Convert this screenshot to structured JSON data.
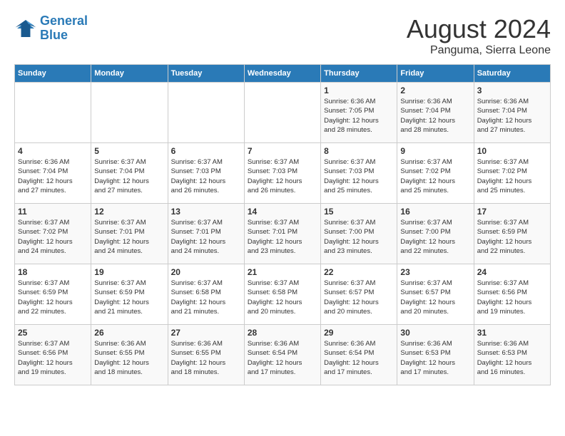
{
  "header": {
    "logo_line1": "General",
    "logo_line2": "Blue",
    "month": "August 2024",
    "location": "Panguma, Sierra Leone"
  },
  "weekdays": [
    "Sunday",
    "Monday",
    "Tuesday",
    "Wednesday",
    "Thursday",
    "Friday",
    "Saturday"
  ],
  "weeks": [
    [
      {
        "day": "",
        "info": ""
      },
      {
        "day": "",
        "info": ""
      },
      {
        "day": "",
        "info": ""
      },
      {
        "day": "",
        "info": ""
      },
      {
        "day": "1",
        "info": "Sunrise: 6:36 AM\nSunset: 7:05 PM\nDaylight: 12 hours\nand 28 minutes."
      },
      {
        "day": "2",
        "info": "Sunrise: 6:36 AM\nSunset: 7:04 PM\nDaylight: 12 hours\nand 28 minutes."
      },
      {
        "day": "3",
        "info": "Sunrise: 6:36 AM\nSunset: 7:04 PM\nDaylight: 12 hours\nand 27 minutes."
      }
    ],
    [
      {
        "day": "4",
        "info": "Sunrise: 6:36 AM\nSunset: 7:04 PM\nDaylight: 12 hours\nand 27 minutes."
      },
      {
        "day": "5",
        "info": "Sunrise: 6:37 AM\nSunset: 7:04 PM\nDaylight: 12 hours\nand 27 minutes."
      },
      {
        "day": "6",
        "info": "Sunrise: 6:37 AM\nSunset: 7:03 PM\nDaylight: 12 hours\nand 26 minutes."
      },
      {
        "day": "7",
        "info": "Sunrise: 6:37 AM\nSunset: 7:03 PM\nDaylight: 12 hours\nand 26 minutes."
      },
      {
        "day": "8",
        "info": "Sunrise: 6:37 AM\nSunset: 7:03 PM\nDaylight: 12 hours\nand 25 minutes."
      },
      {
        "day": "9",
        "info": "Sunrise: 6:37 AM\nSunset: 7:02 PM\nDaylight: 12 hours\nand 25 minutes."
      },
      {
        "day": "10",
        "info": "Sunrise: 6:37 AM\nSunset: 7:02 PM\nDaylight: 12 hours\nand 25 minutes."
      }
    ],
    [
      {
        "day": "11",
        "info": "Sunrise: 6:37 AM\nSunset: 7:02 PM\nDaylight: 12 hours\nand 24 minutes."
      },
      {
        "day": "12",
        "info": "Sunrise: 6:37 AM\nSunset: 7:01 PM\nDaylight: 12 hours\nand 24 minutes."
      },
      {
        "day": "13",
        "info": "Sunrise: 6:37 AM\nSunset: 7:01 PM\nDaylight: 12 hours\nand 24 minutes."
      },
      {
        "day": "14",
        "info": "Sunrise: 6:37 AM\nSunset: 7:01 PM\nDaylight: 12 hours\nand 23 minutes."
      },
      {
        "day": "15",
        "info": "Sunrise: 6:37 AM\nSunset: 7:00 PM\nDaylight: 12 hours\nand 23 minutes."
      },
      {
        "day": "16",
        "info": "Sunrise: 6:37 AM\nSunset: 7:00 PM\nDaylight: 12 hours\nand 22 minutes."
      },
      {
        "day": "17",
        "info": "Sunrise: 6:37 AM\nSunset: 6:59 PM\nDaylight: 12 hours\nand 22 minutes."
      }
    ],
    [
      {
        "day": "18",
        "info": "Sunrise: 6:37 AM\nSunset: 6:59 PM\nDaylight: 12 hours\nand 22 minutes."
      },
      {
        "day": "19",
        "info": "Sunrise: 6:37 AM\nSunset: 6:59 PM\nDaylight: 12 hours\nand 21 minutes."
      },
      {
        "day": "20",
        "info": "Sunrise: 6:37 AM\nSunset: 6:58 PM\nDaylight: 12 hours\nand 21 minutes."
      },
      {
        "day": "21",
        "info": "Sunrise: 6:37 AM\nSunset: 6:58 PM\nDaylight: 12 hours\nand 20 minutes."
      },
      {
        "day": "22",
        "info": "Sunrise: 6:37 AM\nSunset: 6:57 PM\nDaylight: 12 hours\nand 20 minutes."
      },
      {
        "day": "23",
        "info": "Sunrise: 6:37 AM\nSunset: 6:57 PM\nDaylight: 12 hours\nand 20 minutes."
      },
      {
        "day": "24",
        "info": "Sunrise: 6:37 AM\nSunset: 6:56 PM\nDaylight: 12 hours\nand 19 minutes."
      }
    ],
    [
      {
        "day": "25",
        "info": "Sunrise: 6:37 AM\nSunset: 6:56 PM\nDaylight: 12 hours\nand 19 minutes."
      },
      {
        "day": "26",
        "info": "Sunrise: 6:36 AM\nSunset: 6:55 PM\nDaylight: 12 hours\nand 18 minutes."
      },
      {
        "day": "27",
        "info": "Sunrise: 6:36 AM\nSunset: 6:55 PM\nDaylight: 12 hours\nand 18 minutes."
      },
      {
        "day": "28",
        "info": "Sunrise: 6:36 AM\nSunset: 6:54 PM\nDaylight: 12 hours\nand 17 minutes."
      },
      {
        "day": "29",
        "info": "Sunrise: 6:36 AM\nSunset: 6:54 PM\nDaylight: 12 hours\nand 17 minutes."
      },
      {
        "day": "30",
        "info": "Sunrise: 6:36 AM\nSunset: 6:53 PM\nDaylight: 12 hours\nand 17 minutes."
      },
      {
        "day": "31",
        "info": "Sunrise: 6:36 AM\nSunset: 6:53 PM\nDaylight: 12 hours\nand 16 minutes."
      }
    ]
  ]
}
